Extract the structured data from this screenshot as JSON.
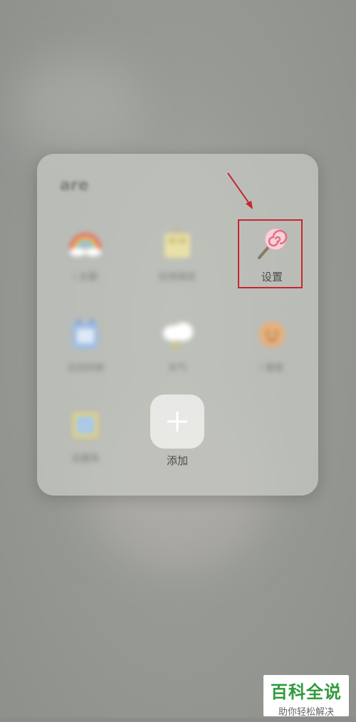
{
  "folder": {
    "title": "are",
    "apps": [
      {
        "label": "i 主题",
        "icon": "rainbow-icon"
      },
      {
        "label": "应用商店",
        "icon": "shopping-bag-icon"
      },
      {
        "label": "设置",
        "icon": "lollipop-settings-icon"
      },
      {
        "label": "日历时钟",
        "icon": "calendar-icon"
      },
      {
        "label": "天气",
        "icon": "weather-cloud-icon"
      },
      {
        "label": "i 管家",
        "icon": "manager-face-icon"
      },
      {
        "label": "云服务",
        "icon": "photo-icon"
      },
      {
        "label": "添加",
        "icon": "plus-icon"
      }
    ]
  },
  "watermark": {
    "main": "百科全说",
    "sub": "助你轻松解决"
  },
  "colors": {
    "highlight": "#c8262d",
    "watermark_green": "#2f9a3c"
  }
}
